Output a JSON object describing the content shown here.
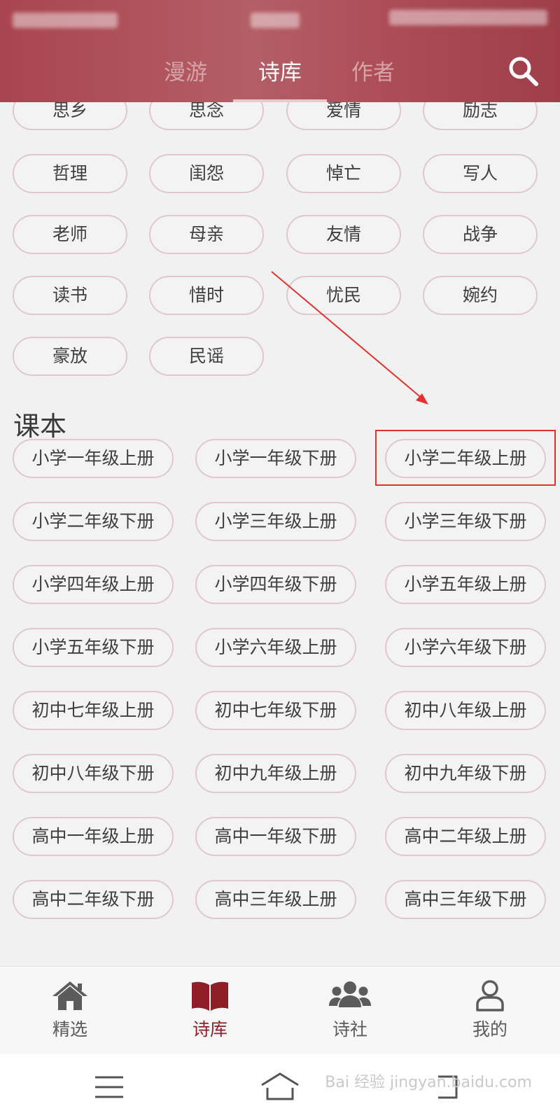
{
  "header": {
    "tabs": [
      {
        "label": "漫游"
      },
      {
        "label": "诗库"
      },
      {
        "label": "作者"
      }
    ],
    "active_tab_index": 1,
    "colors": {
      "header_bg": "#ac4c57",
      "active_tab": "#ffffff",
      "inactive_tab": "#d6a3a8"
    },
    "search_icon": "search-icon"
  },
  "themes": {
    "partial_row": [
      "思乡",
      "思念",
      "爱情",
      "励志"
    ],
    "rows": [
      [
        "哲理",
        "闺怨",
        "悼亡",
        "写人"
      ],
      [
        "老师",
        "母亲",
        "友情",
        "战争"
      ],
      [
        "读书",
        "惜时",
        "忧民",
        "婉约"
      ],
      [
        "豪放",
        "民谣"
      ]
    ]
  },
  "textbook": {
    "title": "课本",
    "items": [
      "小学一年级上册",
      "小学一年级下册",
      "小学二年级上册",
      "小学二年级下册",
      "小学三年级上册",
      "小学三年级下册",
      "小学四年级上册",
      "小学四年级下册",
      "小学五年级上册",
      "小学五年级下册",
      "小学六年级上册",
      "小学六年级下册",
      "初中七年级上册",
      "初中七年级下册",
      "初中八年级上册",
      "初中八年级下册",
      "初中九年级上册",
      "初中九年级下册",
      "高中一年级上册",
      "高中一年级下册",
      "高中二年级上册",
      "高中二年级下册",
      "高中三年级上册",
      "高中三年级下册"
    ],
    "highlighted_item": "小学二年级上册",
    "annotation_color": "#e0332f"
  },
  "bottom_nav": {
    "items": [
      {
        "label": "精选",
        "icon": "home-icon"
      },
      {
        "label": "诗库",
        "icon": "book-icon"
      },
      {
        "label": "诗社",
        "icon": "group-icon"
      },
      {
        "label": "我的",
        "icon": "user-icon"
      }
    ],
    "active_index": 1,
    "active_color": "#8f1e28"
  },
  "system_bar": {
    "buttons": [
      "menu-icon",
      "home-outline-icon",
      "back-icon"
    ],
    "watermark": "Bai 经验 jingyan.baidu.com"
  }
}
